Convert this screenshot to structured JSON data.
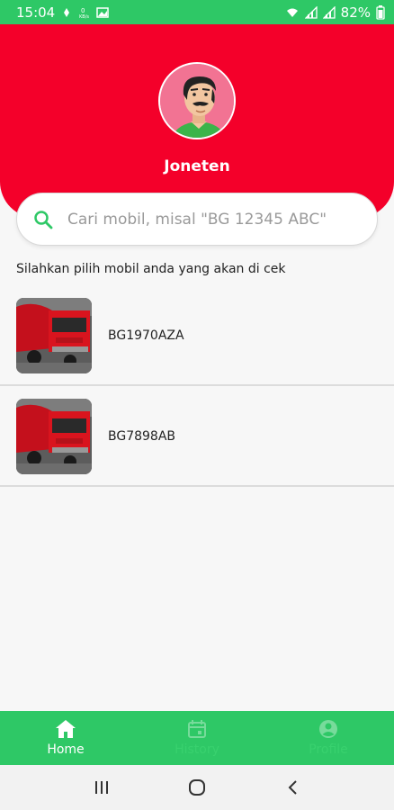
{
  "status_bar": {
    "time": "15:04",
    "battery": "82%"
  },
  "header": {
    "user_name": "Joneten",
    "header_color": "#f4002a"
  },
  "search": {
    "placeholder": "Cari mobil, misal \"BG 12345 ABC\""
  },
  "instruction": "Silahkan pilih mobil anda yang akan di cek",
  "cars": [
    {
      "plate": "BG1970AZA",
      "icon": "red-truck-thumbnail"
    },
    {
      "plate": "BG7898AB",
      "icon": "red-truck-thumbnail"
    }
  ],
  "bottom_nav": {
    "items": [
      {
        "label": "Home",
        "icon": "home-icon",
        "active": true
      },
      {
        "label": "History",
        "icon": "calendar-icon",
        "active": false
      },
      {
        "label": "Profile",
        "icon": "profile-icon",
        "active": false
      }
    ],
    "color": "#2ec866"
  },
  "system_nav": {
    "recent": "recent-apps-icon",
    "home": "home-circle-icon",
    "back": "back-icon"
  }
}
